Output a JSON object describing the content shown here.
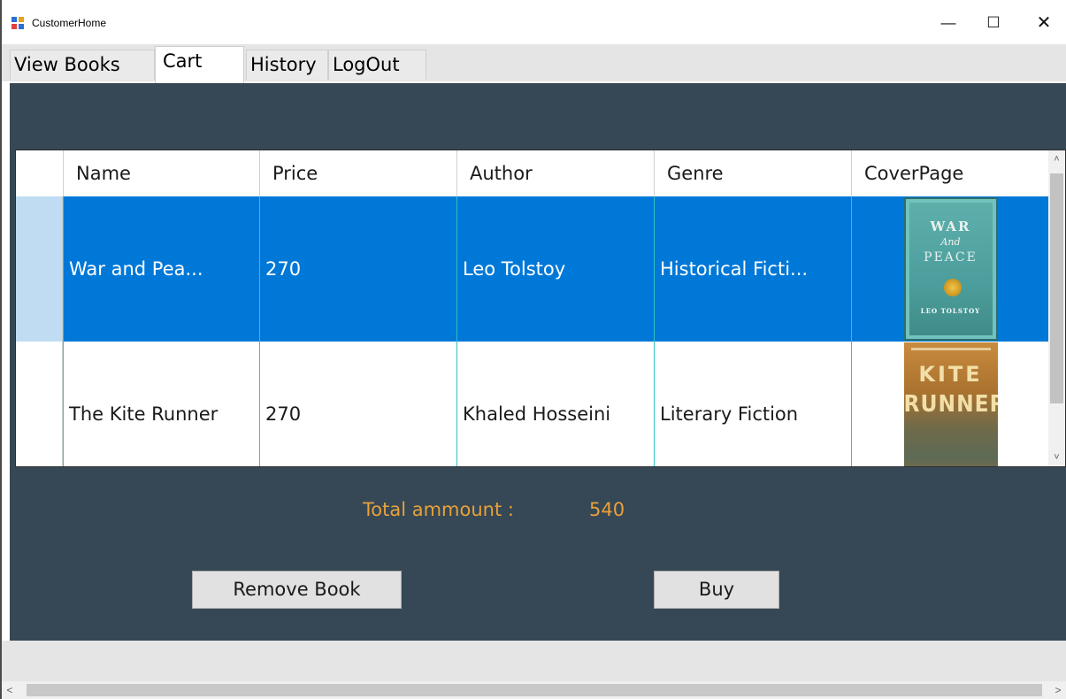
{
  "window": {
    "title": "CustomerHome",
    "minimize_glyph": "—",
    "maximize_glyph": "☐",
    "close_glyph": "✕"
  },
  "tabs": [
    {
      "label": "View Books",
      "active": false
    },
    {
      "label": "Cart",
      "active": true
    },
    {
      "label": "History",
      "active": false
    },
    {
      "label": "LogOut",
      "active": false
    }
  ],
  "grid": {
    "columns": [
      "Name",
      "Price",
      "Author",
      "Genre",
      "CoverPage"
    ],
    "rows": [
      {
        "name": "War and Pea...",
        "price": "270",
        "author": "Leo Tolstoy",
        "genre": "Historical Ficti...",
        "cover": {
          "line1": "WAR",
          "line2": "And",
          "line3": "PEACE",
          "line4": "LEO TOLSTOY"
        },
        "selected": true
      },
      {
        "name": "The Kite Runner",
        "price": "270",
        "author": "Khaled Hosseini",
        "genre": "Literary Fiction",
        "cover": {
          "line1": "KITE",
          "line2": "RUNNER"
        },
        "selected": false
      }
    ]
  },
  "total": {
    "label": "Total ammount :",
    "value": "540"
  },
  "buttons": {
    "remove": "Remove Book",
    "buy": "Buy"
  },
  "scroll": {
    "up": "˄",
    "down": "˅",
    "left": "<",
    "right": ">"
  },
  "colors": {
    "panel": "#364855",
    "selection": "#0078d7",
    "total_text": "#e8a13a",
    "grid_lines": "#2ec4c4"
  }
}
